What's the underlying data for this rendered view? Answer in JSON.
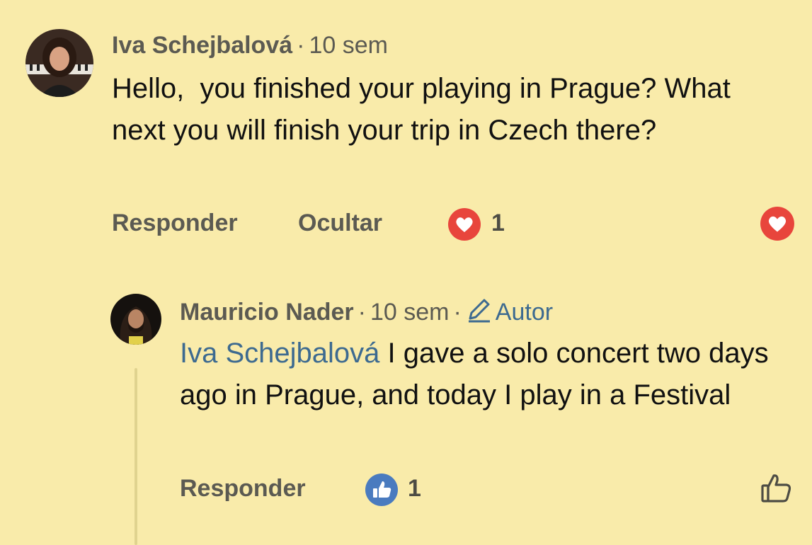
{
  "comments": [
    {
      "author": "Iva Schejbalová",
      "time": "10 sem",
      "text": "Hello,  you finished your playing in Prague? What next you will finish your trip in Czech there?",
      "reply_label": "Responder",
      "hide_label": "Ocultar",
      "reaction_count": "1",
      "reaction_icon": "heart-reaction-icon"
    },
    {
      "author": "Mauricio Nader",
      "time": "10 sem",
      "author_badge": "Autor",
      "mention": "Iva Schejbalová",
      "text": "I gave a solo concert two days ago in Prague, and today I play in a Festival",
      "reply_label": "Responder",
      "reaction_count": "1",
      "reaction_icon": "like-reaction-icon"
    }
  ],
  "colors": {
    "background": "#f9ebaa",
    "heart": "#e8453c",
    "like": "#4a7bbf",
    "mention": "#3d6a90"
  }
}
